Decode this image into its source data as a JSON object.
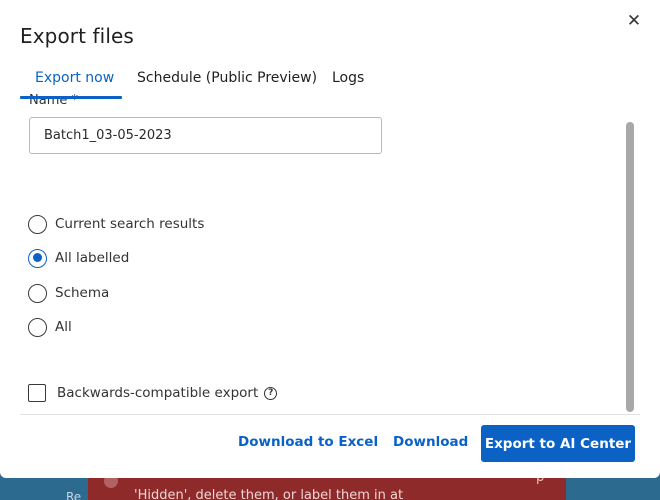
{
  "dialog": {
    "title": "Export files",
    "close_glyph": "✕"
  },
  "tabs": [
    {
      "label": "Export now",
      "active": true
    },
    {
      "label": "Schedule (Public Preview)",
      "active": false
    },
    {
      "label": "Logs",
      "active": false
    }
  ],
  "form": {
    "name_label": "Name *",
    "name_value": "Batch1_03-05-2023",
    "options": [
      {
        "label": "Current search results",
        "checked": false
      },
      {
        "label": "All labelled",
        "checked": true
      },
      {
        "label": "Schema",
        "checked": false
      },
      {
        "label": "All",
        "checked": false
      }
    ],
    "backwards_compat_label": "Backwards-compatible export",
    "backwards_compat_checked": false,
    "help_glyph": "?"
  },
  "footer": {
    "download_excel": "Download to Excel",
    "download": "Download",
    "export_ai": "Export to AI Center"
  },
  "background": {
    "toast_text": "'Hidden', delete them, or label them in at",
    "left_text": "Re",
    "right_mark": "p"
  },
  "colors": {
    "accent": "#0b62c4",
    "toast": "#8e2a2a",
    "page_bg": "#2d6a8f"
  }
}
